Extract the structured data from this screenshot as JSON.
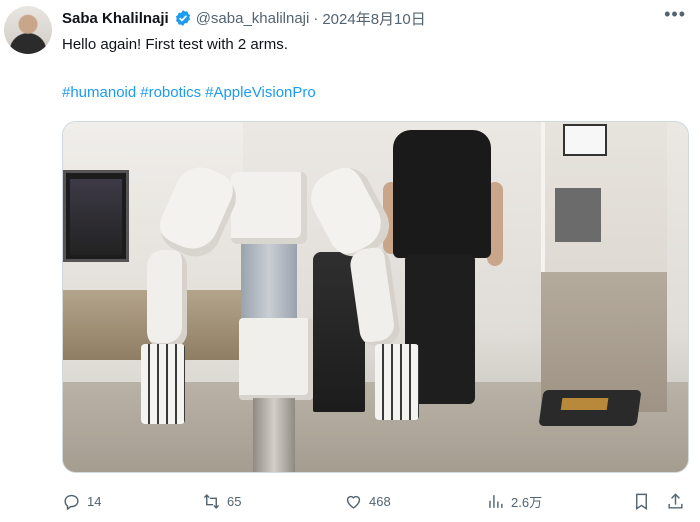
{
  "author": {
    "name": "Saba Khalilnaji",
    "handle": "@saba_khalilnaji",
    "separator": "·",
    "date": "2024年8月10日",
    "verified": true
  },
  "tweet": {
    "text": "Hello again! First test with 2 arms.",
    "hashtags": [
      "#humanoid",
      "#robotics",
      "#AppleVisionPro"
    ]
  },
  "metrics": {
    "replies": "14",
    "retweets": "65",
    "likes": "468",
    "views": "2.6万"
  },
  "icons": {
    "more": "more-icon",
    "reply": "reply-icon",
    "retweet": "retweet-icon",
    "like": "heart-icon",
    "views": "views-icon",
    "bookmark": "bookmark-icon",
    "share": "share-icon"
  },
  "colors": {
    "link": "#1d9bf0",
    "muted": "#536471",
    "text": "#0f1419"
  }
}
